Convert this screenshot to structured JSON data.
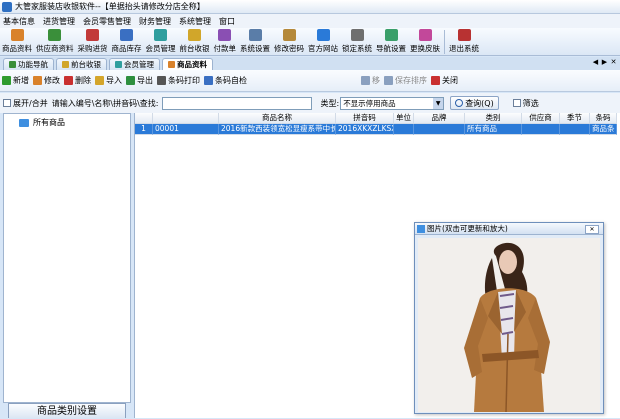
{
  "window": {
    "title": "大管家服装店收银软件--【单据抬头请修改分店全称】"
  },
  "menu": [
    "基本信息",
    "进货管理",
    "会员零售管理",
    "财务管理",
    "系统管理",
    "窗口"
  ],
  "toolbar": [
    {
      "label": "商品资料",
      "icon": "goods-icon",
      "color": "#d9822b"
    },
    {
      "label": "供应商资料",
      "icon": "supplier-icon",
      "color": "#3a8f3a"
    },
    {
      "label": "采购进货",
      "icon": "purchase-icon",
      "color": "#c23a3a"
    },
    {
      "label": "商品库存",
      "icon": "inventory-icon",
      "color": "#3a6fc2"
    },
    {
      "label": "会员管理",
      "icon": "member-icon",
      "color": "#2f9e9e"
    },
    {
      "label": "前台收银",
      "icon": "cashier-icon",
      "color": "#d1a62a"
    },
    {
      "label": "付款单",
      "icon": "payment-icon",
      "color": "#8a4fb3"
    },
    {
      "label": "系统设置",
      "icon": "settings-icon",
      "color": "#5a7da8"
    },
    {
      "label": "修改密码",
      "icon": "password-icon",
      "color": "#b5893a"
    },
    {
      "label": "官方网站",
      "icon": "website-icon",
      "color": "#2a7ad8"
    },
    {
      "label": "锁定系统",
      "icon": "lock-icon",
      "color": "#6f6f6f"
    },
    {
      "label": "导航设置",
      "icon": "navigation-icon",
      "color": "#3a9f6a"
    },
    {
      "label": "更换皮肤",
      "icon": "skin-icon",
      "color": "#c2489a"
    },
    {
      "label": "退出系统",
      "icon": "exit-icon",
      "color": "#b83232"
    }
  ],
  "tabs": [
    {
      "label": "功能导航",
      "color": "#3a8f3a"
    },
    {
      "label": "前台收银",
      "color": "#d1a62a"
    },
    {
      "label": "会员管理",
      "color": "#2f9e9e"
    },
    {
      "label": "商品资料",
      "color": "#d9822b",
      "active": true
    }
  ],
  "tab_controls": [
    "◀",
    "▶",
    "✕"
  ],
  "actions": [
    {
      "label": "新增",
      "icon": "add-icon",
      "color": "#2e9b2e"
    },
    {
      "label": "修改",
      "icon": "edit-icon",
      "color": "#d9822b"
    },
    {
      "label": "删除",
      "icon": "delete-icon",
      "color": "#c93030"
    },
    {
      "label": "导入",
      "icon": "import-icon",
      "color": "#d4a52a"
    },
    {
      "label": "导出",
      "icon": "export-icon",
      "color": "#2e8f3e"
    },
    {
      "label": "条码打印",
      "icon": "barcode-print-icon",
      "color": "#555555"
    },
    {
      "label": "条码自检",
      "icon": "barcode-check-icon",
      "color": "#3a6fc2"
    },
    {
      "label": "移",
      "icon": "move-icon",
      "color": "#8aa0bf",
      "disabled": true
    },
    {
      "label": "保存排序",
      "icon": "save-sort-icon",
      "color": "#8aa0bf",
      "disabled": true
    },
    {
      "label": "关闭",
      "icon": "close-icon",
      "color": "#c93030"
    }
  ],
  "search": {
    "expand_label": "展开/合并",
    "prompt": "请输入编号\\名称\\拼音码\\查找:",
    "type_label": "类型:",
    "type_value": "不显示停用商品",
    "query_label": "查询(Q)",
    "filter_label": "筛选"
  },
  "tree": {
    "root": "所有商品"
  },
  "category_button": "商品类别设置",
  "table": {
    "columns": [
      "",
      "",
      "商品名称",
      "拼音码",
      "单位",
      "品牌",
      "类别",
      "供应商",
      "季节",
      "条码"
    ],
    "rows": [
      [
        "1",
        "00001",
        "2016新款西装领宽松显瘦系带中长",
        "2016XKXZLKSX",
        "",
        "",
        "所有商品",
        "",
        "",
        "商品条"
      ]
    ]
  },
  "photo_window": {
    "title": "图片(双击可更新和放大)",
    "close_label": "✕"
  }
}
